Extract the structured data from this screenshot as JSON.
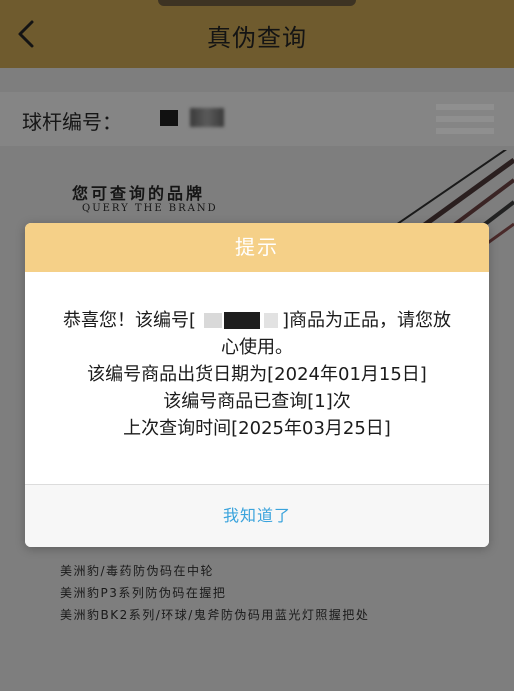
{
  "header": {
    "title": "真伪查询"
  },
  "serial": {
    "label": "球杆编号："
  },
  "brand": {
    "title": "您可查询的品牌",
    "subtitle": "QUERY THE BRAND"
  },
  "notes": [
    "美洲豹/毒药防伪码在中轮",
    "美洲豹P3系列防伪码在握把",
    "美洲豹BK2系列/环球/鬼斧防伪码用蓝光灯照握把处"
  ],
  "modal": {
    "title": "提示",
    "message": {
      "line1_prefix": "恭喜您！该编号[",
      "line1_suffix": "]商品为正品，请您放",
      "line2": "心使用。",
      "line3": "该编号商品出货日期为[2024年01月15日]",
      "line4": "该编号商品已查询[1]次",
      "line5": "上次查询时间[2025年03月25日]"
    },
    "confirm_label": "我知道了"
  },
  "colors": {
    "modal_header_bg": "#f5d088",
    "confirm_text": "#3aa3dc",
    "header_bg_dimmed": "#6f5b2e"
  },
  "icons": {
    "back": "chevron-left-icon"
  }
}
